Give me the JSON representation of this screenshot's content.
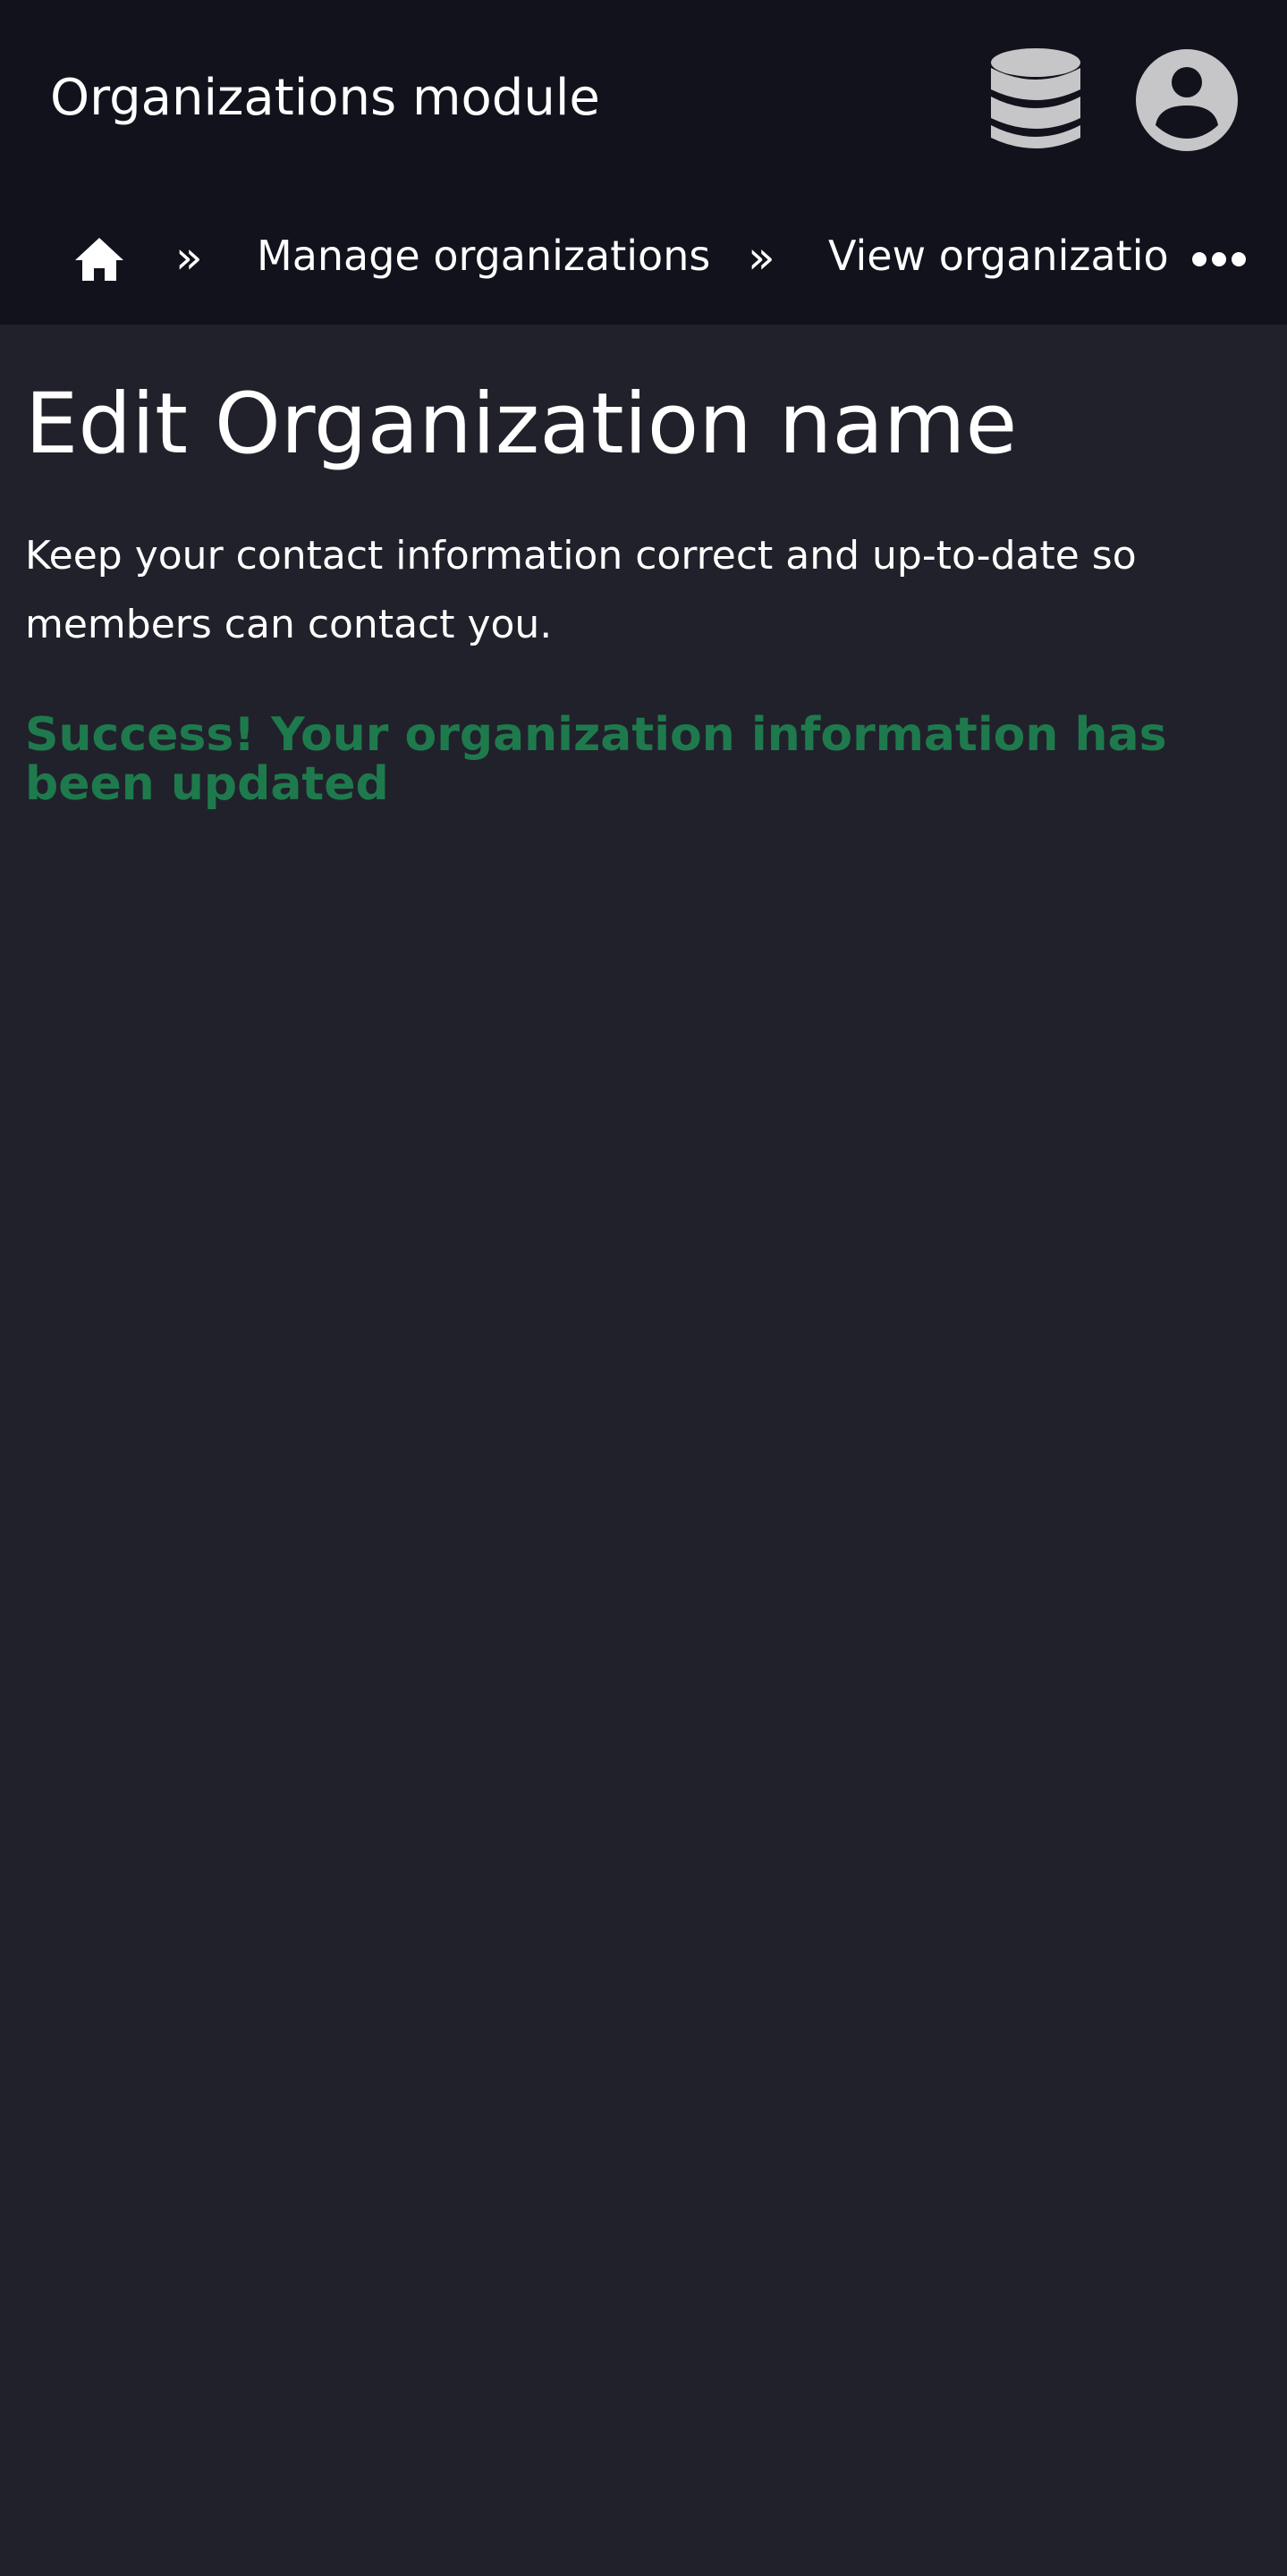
{
  "header": {
    "app_title": "Organizations module",
    "icons": [
      "database-icon",
      "user-avatar-icon"
    ],
    "background": "#11121c"
  },
  "breadcrumb": {
    "home_icon": "home-icon",
    "separator": "»",
    "items": [
      {
        "label": "Manage organizations"
      },
      {
        "label": "View organization"
      }
    ],
    "more_icon": "more-horizontal-icon"
  },
  "main": {
    "title": "Edit Organization name",
    "intro": "Keep your contact information correct and up-to-date so members can contact you.",
    "success_message": "Success! Your organization information has been updated",
    "background": "#21212b"
  },
  "colors": {
    "success": "#1e7a4d",
    "icon_gray": "#c6c6c8",
    "text": "#ffffff"
  }
}
